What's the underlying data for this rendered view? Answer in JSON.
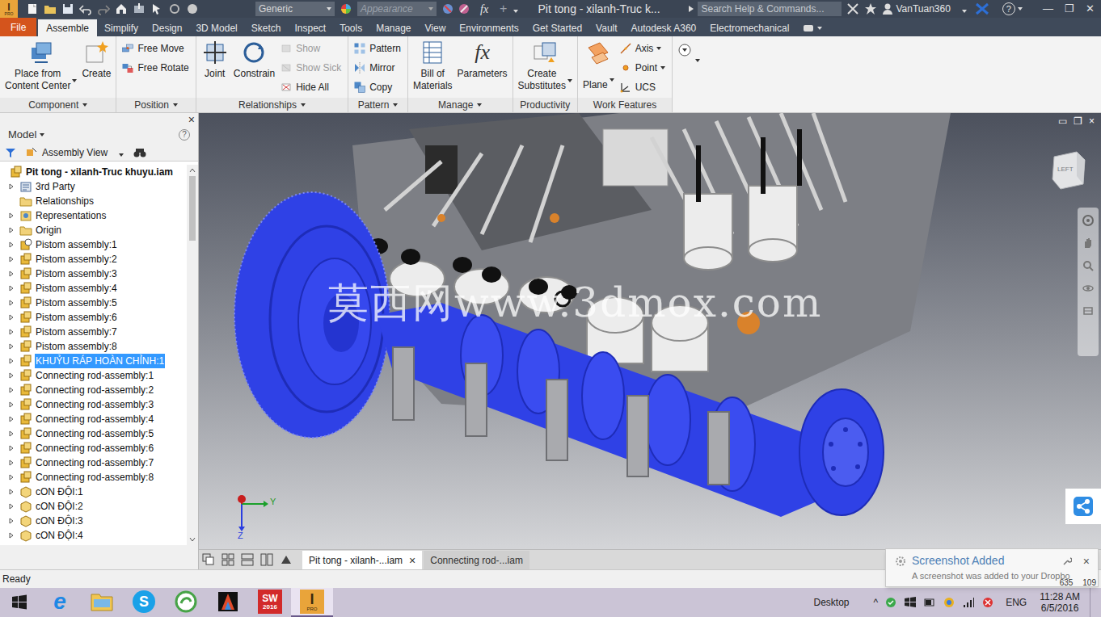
{
  "title_bar": {
    "logo": "I",
    "logo_sub": "PRO",
    "material": "Generic",
    "appearance": "Appearance",
    "fx": "fx",
    "plus": "+",
    "title": "Pit tong - xilanh-Truc k...",
    "search": {
      "placeholder": "Search Help & Commands..."
    },
    "user": "VanTuan360",
    "help": "?",
    "window_controls": [
      "—",
      "❐",
      "✕"
    ]
  },
  "ribbon_tabs": [
    {
      "label": "File",
      "kind": "file",
      "selected": false
    },
    {
      "label": "Assemble",
      "kind": "tab",
      "selected": true
    },
    {
      "label": "Simplify",
      "kind": "tab",
      "selected": false
    },
    {
      "label": "Design",
      "kind": "tab",
      "selected": false
    },
    {
      "label": "3D Model",
      "kind": "tab",
      "selected": false
    },
    {
      "label": "Sketch",
      "kind": "tab",
      "selected": false
    },
    {
      "label": "Inspect",
      "kind": "tab",
      "selected": false
    },
    {
      "label": "Tools",
      "kind": "tab",
      "selected": false
    },
    {
      "label": "Manage",
      "kind": "tab",
      "selected": false
    },
    {
      "label": "View",
      "kind": "tab",
      "selected": false
    },
    {
      "label": "Environments",
      "kind": "tab",
      "selected": false
    },
    {
      "label": "Get Started",
      "kind": "tab",
      "selected": false
    },
    {
      "label": "Vault",
      "kind": "tab",
      "selected": false
    },
    {
      "label": "Autodesk A360",
      "kind": "tab",
      "selected": false
    },
    {
      "label": "Electromechanical",
      "kind": "tab",
      "selected": false
    }
  ],
  "ribbon_groups": [
    {
      "label": "Component",
      "dropdown": true,
      "tools": [
        {
          "label": "Place from\nContent Center",
          "kind": "large",
          "dropdown": true,
          "disabled": false
        },
        {
          "label": "Create",
          "kind": "large",
          "dropdown": false,
          "disabled": false
        }
      ]
    },
    {
      "label": "Position",
      "dropdown": true,
      "tools": [
        {
          "label": "Free Move",
          "kind": "small",
          "dropdown": false,
          "disabled": false
        },
        {
          "label": "Free Rotate",
          "kind": "small",
          "dropdown": false,
          "disabled": false
        }
      ]
    },
    {
      "label": "Relationships",
      "dropdown": true,
      "tools": [
        {
          "label": "Joint",
          "kind": "large",
          "dropdown": false,
          "disabled": false
        },
        {
          "label": "Constrain",
          "kind": "large",
          "dropdown": false,
          "disabled": false
        },
        {
          "label": "Show",
          "kind": "small",
          "dropdown": false,
          "disabled": true
        },
        {
          "label": "Show Sick",
          "kind": "small",
          "dropdown": false,
          "disabled": true
        },
        {
          "label": "Hide All",
          "kind": "small",
          "dropdown": false,
          "disabled": false
        }
      ]
    },
    {
      "label": "Pattern",
      "dropdown": true,
      "tools": [
        {
          "label": "Pattern",
          "kind": "small",
          "dropdown": false,
          "disabled": false
        },
        {
          "label": "Mirror",
          "kind": "small",
          "dropdown": false,
          "disabled": false
        },
        {
          "label": "Copy",
          "kind": "small",
          "dropdown": false,
          "disabled": false
        }
      ]
    },
    {
      "label": "Manage",
      "dropdown": true,
      "tools": [
        {
          "label": "Bill of\nMaterials",
          "kind": "large",
          "dropdown": false,
          "disabled": false
        },
        {
          "label": "Parameters",
          "kind": "large",
          "dropdown": false,
          "disabled": false,
          "glyph": "fx"
        }
      ]
    },
    {
      "label": "Productivity",
      "dropdown": false,
      "tools": [
        {
          "label": "Create\nSubstitutes",
          "kind": "large",
          "dropdown": true,
          "disabled": false
        }
      ]
    },
    {
      "label": "Work Features",
      "dropdown": false,
      "tools": [
        {
          "label": "Plane",
          "kind": "large",
          "dropdown": true,
          "disabled": false
        },
        {
          "label": "Axis",
          "kind": "small",
          "dropdown": true,
          "disabled": false
        },
        {
          "label": "Point",
          "kind": "small",
          "dropdown": true,
          "disabled": false
        },
        {
          "label": "UCS",
          "kind": "small",
          "dropdown": false,
          "disabled": false
        }
      ]
    }
  ],
  "browser": {
    "close": "×",
    "title": "Model",
    "help": "?",
    "view": "Assembly View",
    "items": [
      {
        "label": "Pit tong - xilanh-Truc khuyu.iam",
        "kind": "root",
        "expandable": false,
        "selected": false
      },
      {
        "label": "3rd Party",
        "kind": "thirdparty",
        "expandable": true,
        "selected": false
      },
      {
        "label": "Relationships",
        "kind": "folder",
        "expandable": false,
        "selected": false
      },
      {
        "label": "Representations",
        "kind": "representations",
        "expandable": true,
        "selected": false
      },
      {
        "label": "Origin",
        "kind": "folder",
        "expandable": true,
        "selected": false
      },
      {
        "label": "Pistom assembly:1",
        "kind": "special",
        "expandable": true,
        "selected": false
      },
      {
        "label": "Pistom assembly:2",
        "kind": "assembly",
        "expandable": true,
        "selected": false
      },
      {
        "label": "Pistom assembly:3",
        "kind": "assembly",
        "expandable": true,
        "selected": false
      },
      {
        "label": "Pistom assembly:4",
        "kind": "assembly",
        "expandable": true,
        "selected": false
      },
      {
        "label": "Pistom assembly:5",
        "kind": "assembly",
        "expandable": true,
        "selected": false
      },
      {
        "label": "Pistom assembly:6",
        "kind": "assembly",
        "expandable": true,
        "selected": false
      },
      {
        "label": "Pistom assembly:7",
        "kind": "assembly",
        "expandable": true,
        "selected": false
      },
      {
        "label": "Pistom assembly:8",
        "kind": "assembly",
        "expandable": true,
        "selected": false
      },
      {
        "label": "KHUỶU RÁP HOÀN CHỈNH:1",
        "kind": "assembly",
        "expandable": true,
        "selected": true
      },
      {
        "label": "Connecting rod-assembly:1",
        "kind": "assembly",
        "expandable": true,
        "selected": false
      },
      {
        "label": "Connecting rod-assembly:2",
        "kind": "assembly",
        "expandable": true,
        "selected": false
      },
      {
        "label": "Connecting rod-assembly:3",
        "kind": "assembly",
        "expandable": true,
        "selected": false
      },
      {
        "label": "Connecting rod-assembly:4",
        "kind": "assembly",
        "expandable": true,
        "selected": false
      },
      {
        "label": "Connecting rod-assembly:5",
        "kind": "assembly",
        "expandable": true,
        "selected": false
      },
      {
        "label": "Connecting rod-assembly:6",
        "kind": "assembly",
        "expandable": true,
        "selected": false
      },
      {
        "label": "Connecting rod-assembly:7",
        "kind": "assembly",
        "expandable": true,
        "selected": false
      },
      {
        "label": "Connecting rod-assembly:8",
        "kind": "assembly",
        "expandable": true,
        "selected": false
      },
      {
        "label": "cON ĐỘI:1",
        "kind": "part",
        "expandable": true,
        "selected": false
      },
      {
        "label": "cON ĐỘI:2",
        "kind": "part",
        "expandable": true,
        "selected": false
      },
      {
        "label": "cON ĐỘI:3",
        "kind": "part",
        "expandable": true,
        "selected": false
      },
      {
        "label": "cON ĐỘI:4",
        "kind": "part",
        "expandable": true,
        "selected": false
      }
    ]
  },
  "viewport": {
    "watermark": "莫西网www.3dmox.com",
    "viewcube": "LEFT",
    "axes": [
      "Y",
      "Z"
    ],
    "window_controls": [
      "▭",
      "❐",
      "×"
    ]
  },
  "document_tabs": [
    {
      "label": "Pit tong - xilanh-...iam",
      "selected": true,
      "close": "×"
    },
    {
      "label": "Connecting rod-...iam",
      "selected": false,
      "close": ""
    }
  ],
  "status_bar": {
    "text": "Ready",
    "coords": [
      "635",
      "109"
    ]
  },
  "notification": {
    "title": "Screenshot Added",
    "message": "A screenshot was added to your Dropbo",
    "close": "×"
  },
  "taskbar": {
    "apps": [
      {
        "kind": "ie",
        "active": false,
        "badge": "e",
        "sub": ""
      },
      {
        "kind": "explorer",
        "active": false,
        "badge": "",
        "sub": ""
      },
      {
        "kind": "skype",
        "active": false,
        "badge": "S",
        "sub": ""
      },
      {
        "kind": "green",
        "active": false,
        "badge": "",
        "sub": ""
      },
      {
        "kind": "media",
        "active": false,
        "badge": "",
        "sub": ""
      },
      {
        "kind": "solidworks",
        "active": false,
        "badge": "SW",
        "sub": "2016"
      },
      {
        "kind": "inventor",
        "active": true,
        "badge": "I",
        "sub": "PRO"
      }
    ],
    "desktop": "Desktop",
    "chevron": "^",
    "language": "ENG",
    "time": "11:28 AM",
    "date": "6/5/2016"
  }
}
